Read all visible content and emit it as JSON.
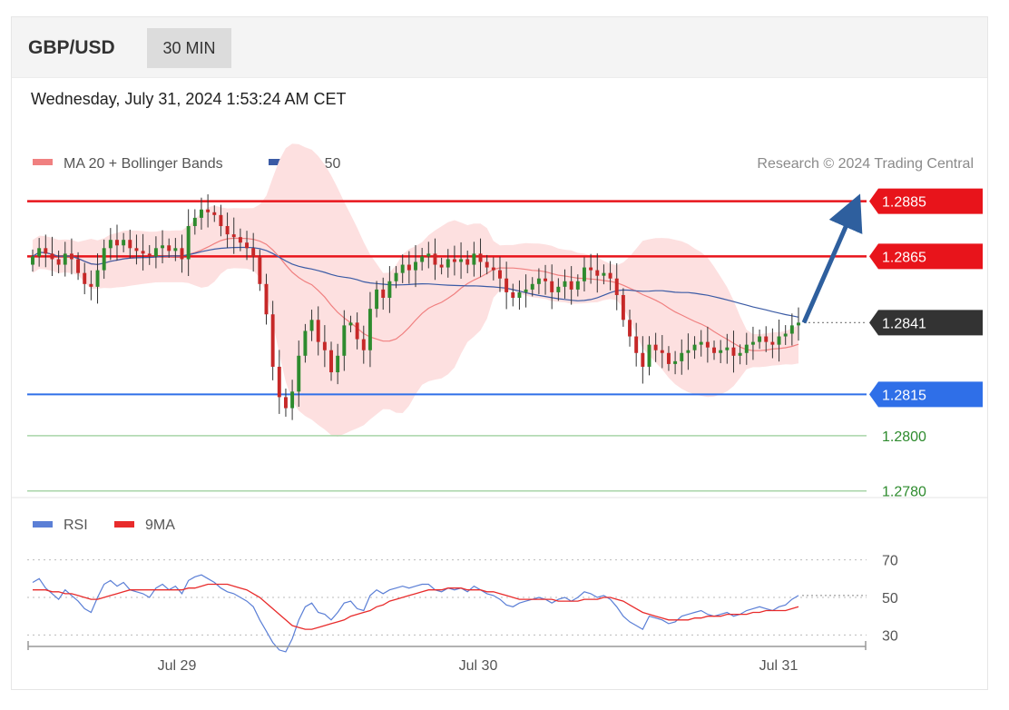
{
  "header": {
    "symbol": "GBP/USD",
    "timeframe": "30 MIN"
  },
  "datetime": "Wednesday, July 31, 2024 1:53:24 AM CET",
  "legend": {
    "ma20_bb": "MA 20 + Bollinger Bands",
    "ma50": "MA 50",
    "credit": "Research © 2024 Trading Central",
    "rsi": "RSI",
    "rsi_ma": "9MA"
  },
  "colors": {
    "resistance": "#e8141b",
    "current": "#333333",
    "support": "#2f6fe8",
    "targets": "#2e8b2e",
    "candle_up": "#2e8b2e",
    "candle_down": "#c62828",
    "bollinger_fill": "#fde0e0",
    "ma20": "#f08080",
    "ma50": "#3b5ba5",
    "rsi": "#5b7fd6",
    "rsi_ma": "#e82b2b",
    "arrow": "#2e5f9e"
  },
  "chart_data": [
    {
      "type": "candlestick",
      "title": "GBP/USD",
      "xlabel": "",
      "ylabel": "",
      "ylim": [
        1.2772,
        1.2902
      ],
      "x_ticks": [
        "Jul 29",
        "Jul 30",
        "Jul 31"
      ],
      "levels": [
        {
          "value": 1.2885,
          "label": "1.2885",
          "role": "resistance"
        },
        {
          "value": 1.2865,
          "label": "1.2865",
          "role": "resistance"
        },
        {
          "value": 1.2841,
          "label": "1.2841",
          "role": "current"
        },
        {
          "value": 1.2815,
          "label": "1.2815",
          "role": "support"
        },
        {
          "value": 1.28,
          "label": "1.2800",
          "role": "target"
        },
        {
          "value": 1.278,
          "label": "1.2780",
          "role": "target"
        }
      ],
      "projection": {
        "from": 1.2841,
        "to": 1.2885,
        "direction": "up"
      },
      "close": [
        1.2865,
        1.2868,
        1.2866,
        1.2864,
        1.2862,
        1.2866,
        1.2864,
        1.2859,
        1.2855,
        1.2854,
        1.286,
        1.2868,
        1.2871,
        1.2869,
        1.2871,
        1.2868,
        1.2867,
        1.2866,
        1.2865,
        1.2868,
        1.2869,
        1.2867,
        1.2868,
        1.2864,
        1.2876,
        1.2879,
        1.2882,
        1.2881,
        1.288,
        1.2876,
        1.2873,
        1.2872,
        1.287,
        1.2868,
        1.2865,
        1.2855,
        1.2844,
        1.2825,
        1.2814,
        1.281,
        1.2816,
        1.2829,
        1.2838,
        1.2842,
        1.2834,
        1.2831,
        1.2823,
        1.2829,
        1.284,
        1.2841,
        1.2835,
        1.2831,
        1.2846,
        1.2853,
        1.285,
        1.2856,
        1.2859,
        1.2862,
        1.286,
        1.2863,
        1.2865,
        1.2866,
        1.2862,
        1.2861,
        1.2864,
        1.2863,
        1.2864,
        1.2862,
        1.2866,
        1.2863,
        1.2861,
        1.286,
        1.2857,
        1.2852,
        1.285,
        1.2852,
        1.2853,
        1.2855,
        1.2857,
        1.2856,
        1.2852,
        1.2854,
        1.2856,
        1.2853,
        1.2856,
        1.2861,
        1.286,
        1.2858,
        1.2859,
        1.2857,
        1.2851,
        1.2842,
        1.2836,
        1.283,
        1.2825,
        1.2833,
        1.2831,
        1.283,
        1.2826,
        1.2827,
        1.283,
        1.2831,
        1.2833,
        1.2834,
        1.2832,
        1.283,
        1.2831,
        1.2832,
        1.2829,
        1.283,
        1.2833,
        1.2834,
        1.2836,
        1.2834,
        1.2833,
        1.2836,
        1.2837,
        1.284,
        1.2841
      ]
    },
    {
      "type": "line",
      "title": "",
      "ylim": [
        20,
        80
      ],
      "y_ticks": [
        70,
        50,
        30
      ],
      "x_ticks": [
        "Jul 29",
        "Jul 30",
        "Jul 31"
      ],
      "series": [
        {
          "name": "RSI",
          "values": [
            58,
            60,
            55,
            52,
            49,
            54,
            51,
            48,
            44,
            42,
            50,
            57,
            59,
            56,
            58,
            54,
            53,
            52,
            50,
            55,
            57,
            54,
            56,
            52,
            59,
            61,
            62,
            60,
            58,
            55,
            53,
            52,
            50,
            48,
            45,
            38,
            32,
            26,
            22,
            21,
            28,
            38,
            45,
            47,
            42,
            41,
            38,
            42,
            47,
            48,
            44,
            43,
            51,
            54,
            52,
            54,
            55,
            56,
            55,
            56,
            57,
            57,
            54,
            53,
            55,
            54,
            55,
            53,
            56,
            54,
            52,
            51,
            49,
            46,
            45,
            47,
            48,
            49,
            50,
            49,
            47,
            49,
            50,
            48,
            50,
            53,
            52,
            50,
            51,
            49,
            45,
            40,
            37,
            35,
            33,
            40,
            39,
            38,
            36,
            37,
            40,
            41,
            42,
            43,
            41,
            40,
            41,
            42,
            40,
            41,
            43,
            44,
            45,
            44,
            43,
            45,
            46,
            49,
            51
          ]
        },
        {
          "name": "9MA",
          "values": [
            54,
            54,
            54,
            53,
            53,
            52,
            52,
            51,
            50,
            49,
            49,
            50,
            51,
            52,
            53,
            54,
            54,
            54,
            54,
            54,
            54,
            54,
            54,
            54,
            55,
            55,
            56,
            57,
            57,
            57,
            57,
            56,
            55,
            54,
            52,
            50,
            47,
            44,
            41,
            38,
            35,
            34,
            33,
            33,
            34,
            35,
            36,
            37,
            38,
            40,
            41,
            42,
            43,
            45,
            46,
            48,
            49,
            50,
            51,
            52,
            53,
            54,
            54,
            54,
            55,
            55,
            55,
            54,
            54,
            54,
            53,
            53,
            52,
            51,
            50,
            49,
            49,
            49,
            49,
            49,
            49,
            48,
            48,
            48,
            48,
            49,
            49,
            49,
            50,
            50,
            49,
            48,
            46,
            44,
            42,
            41,
            40,
            39,
            38,
            38,
            38,
            38,
            39,
            39,
            40,
            40,
            40,
            41,
            41,
            41,
            41,
            42,
            42,
            43,
            43,
            43,
            43,
            44,
            45
          ]
        }
      ]
    }
  ]
}
